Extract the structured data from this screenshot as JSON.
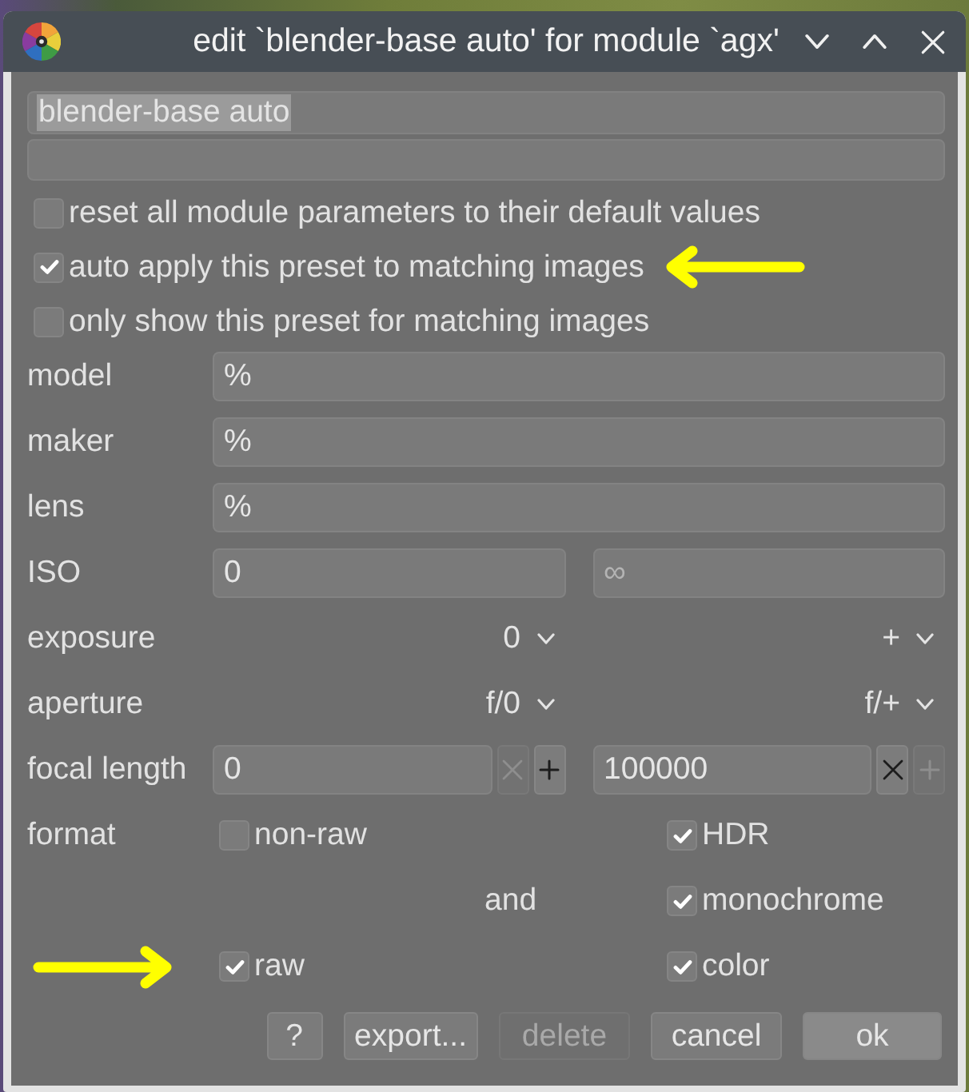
{
  "window": {
    "title": "edit `blender-base auto' for module `agx'"
  },
  "name_field": {
    "value": "blender-base auto",
    "text_selected": true
  },
  "options": [
    {
      "label": "reset all module parameters to their default values",
      "checked": false
    },
    {
      "label": "auto apply this preset to matching images",
      "checked": true
    },
    {
      "label": "only show this preset for matching images",
      "checked": false
    }
  ],
  "text_filters": [
    {
      "label": "model",
      "value": "%"
    },
    {
      "label": "maker",
      "value": "%"
    },
    {
      "label": "lens",
      "value": "%"
    }
  ],
  "iso": {
    "label": "ISO",
    "min": {
      "value": "0"
    },
    "max": {
      "placeholder": "∞"
    }
  },
  "dropdown_filters": [
    {
      "label": "exposure",
      "min": "0",
      "max": "+"
    },
    {
      "label": "aperture",
      "min": "f/0",
      "max": "f/+"
    }
  ],
  "focal_length": {
    "label": "focal length",
    "min": {
      "value": "0",
      "clear_disabled": true,
      "step_disabled": false
    },
    "max": {
      "value": "100000",
      "clear_disabled": false,
      "step_disabled": true
    }
  },
  "format": {
    "label": "format",
    "rows": [
      {
        "left": {
          "label": "non-raw",
          "checked": false
        },
        "right": {
          "label": "HDR",
          "checked": true
        }
      },
      {
        "middle": "and",
        "right": {
          "label": "monochrome",
          "checked": true
        }
      },
      {
        "left": {
          "label": "raw",
          "checked": true
        },
        "right": {
          "label": "color",
          "checked": true
        }
      }
    ]
  },
  "buttons": [
    {
      "label": "?",
      "kind": "help",
      "disabled": false
    },
    {
      "label": "export...",
      "kind": "normal",
      "disabled": false
    },
    {
      "label": "delete",
      "kind": "normal",
      "disabled": true
    },
    {
      "label": "cancel",
      "kind": "normal",
      "disabled": false
    },
    {
      "label": "ok",
      "kind": "default",
      "disabled": false
    }
  ]
}
